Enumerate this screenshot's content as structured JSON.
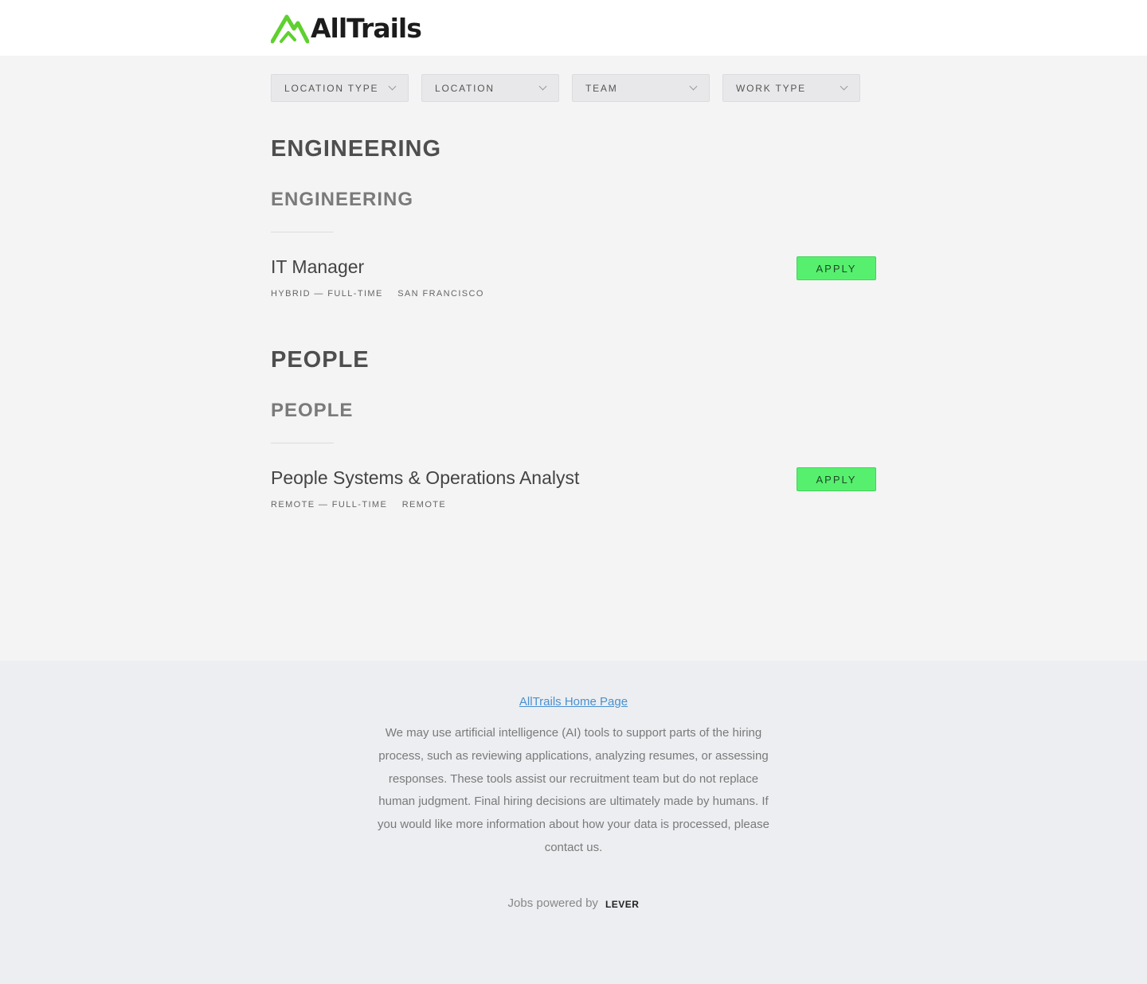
{
  "header": {
    "brand_name": "AllTrails",
    "brand_color": "#5fd02f"
  },
  "filters": [
    {
      "label": "LOCATION TYPE"
    },
    {
      "label": "LOCATION"
    },
    {
      "label": "TEAM"
    },
    {
      "label": "WORK TYPE"
    }
  ],
  "groups": [
    {
      "title": "ENGINEERING",
      "subtitle": "ENGINEERING",
      "postings": [
        {
          "title": "IT Manager",
          "commitment": "HYBRID — FULL-TIME",
          "location": "SAN FRANCISCO",
          "apply_label": "APPLY"
        }
      ]
    },
    {
      "title": "PEOPLE",
      "subtitle": "PEOPLE",
      "postings": [
        {
          "title": "People Systems & Operations Analyst",
          "commitment": "REMOTE — FULL-TIME",
          "location": "REMOTE",
          "apply_label": "APPLY"
        }
      ]
    }
  ],
  "footer": {
    "home_link": "AllTrails Home Page",
    "disclaimer": "We may use artificial intelligence (AI) tools to support parts of the hiring process, such as reviewing applications, analyzing resumes, or assessing responses. These tools assist our recruitment team but do not replace human judgment. Final hiring decisions are ultimately made by humans. If you would like more information about how your data is processed, please contact us.",
    "powered_by": "Jobs powered by",
    "powered_brand": "LEVER"
  },
  "colors": {
    "apply_button": "#56f06e",
    "link": "#4a90d0"
  }
}
